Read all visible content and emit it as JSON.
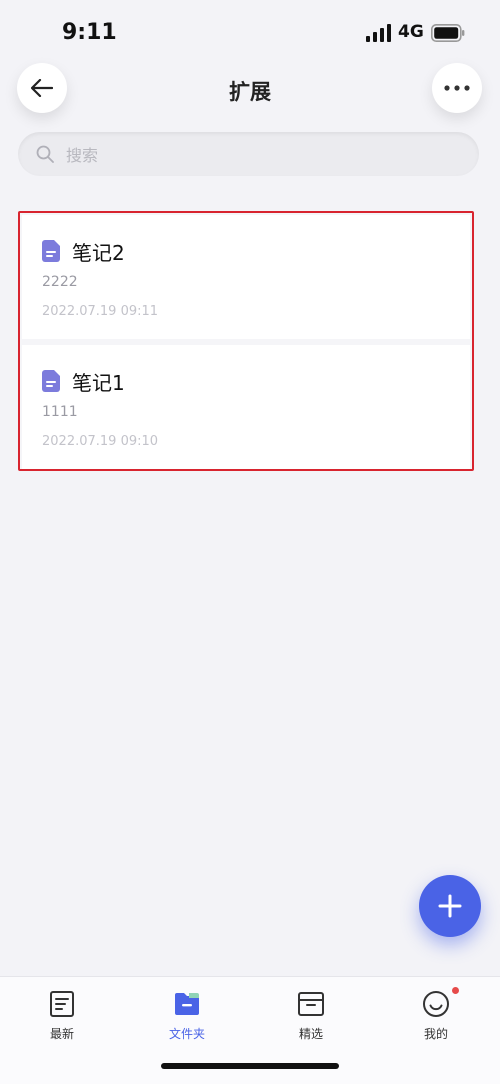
{
  "status_bar": {
    "time": "9:11",
    "network": "4G"
  },
  "header": {
    "title": "扩展"
  },
  "search": {
    "placeholder": "搜索"
  },
  "notes": [
    {
      "title": "笔记2",
      "preview": "2222",
      "date": "2022.07.19 09:11"
    },
    {
      "title": "笔记1",
      "preview": "1111",
      "date": "2022.07.19 09:10"
    }
  ],
  "tabbar": {
    "items": [
      {
        "label": "最新"
      },
      {
        "label": "文件夹",
        "active": true
      },
      {
        "label": "精选"
      },
      {
        "label": "我的"
      }
    ]
  },
  "colors": {
    "accent": "#4a63e6",
    "doc_icon": "#7c7bdc",
    "highlight_border": "#d8242f",
    "badge": "#e64a4a"
  },
  "icons": [
    "back-arrow-icon",
    "more-icon",
    "search-icon",
    "document-icon",
    "plus-icon",
    "newest-icon",
    "folder-icon",
    "featured-icon",
    "profile-icon"
  ]
}
